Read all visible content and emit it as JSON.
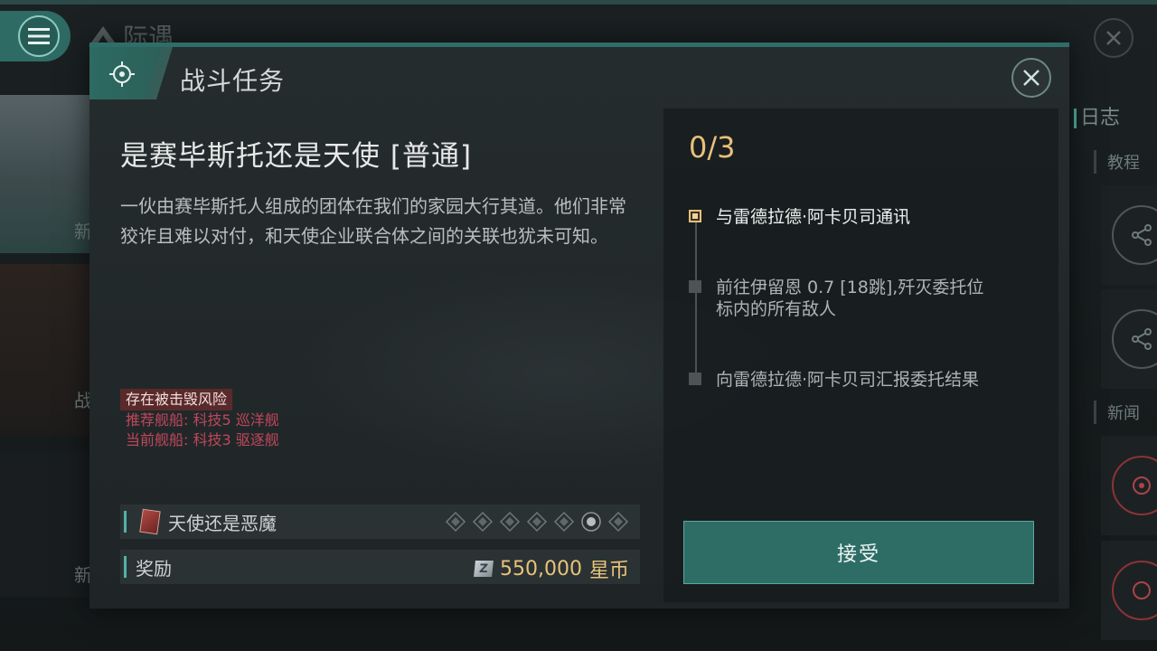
{
  "background": {
    "title": "际遇",
    "left_labels": [
      "新",
      "战",
      "新"
    ],
    "right_panel": {
      "title": "日志",
      "sections": [
        "教程",
        "新闻"
      ]
    }
  },
  "modal": {
    "header_title": "战斗任务",
    "mission_title": "是赛毕斯托还是天使 [普通]",
    "description": "一伙由赛毕斯托人组成的团体在我们的家园大行其道。他们非常狡诈且难以对付，和天使企业联合体之间的关联也犹未可知。",
    "risk": {
      "tag": "存在被击毁风险",
      "recommended": "推荐舰船: 科技5 巡洋舰",
      "current": "当前舰船: 科技3 驱逐舰"
    },
    "item_row": {
      "label": "天使还是恶魔",
      "icon": "mission-card-icon",
      "slots": [
        {
          "filled": false
        },
        {
          "filled": false
        },
        {
          "filled": false
        },
        {
          "filled": false
        },
        {
          "filled": false
        },
        {
          "filled": true
        },
        {
          "filled": false
        }
      ]
    },
    "reward_row": {
      "label": "奖励",
      "amount": "550,000",
      "unit": "星币",
      "icon": "star-coin-icon"
    },
    "objectives": {
      "progress": "0/3",
      "items": [
        {
          "text": "与雷德拉德·阿卡贝司通讯",
          "active": true
        },
        {
          "text": "前往伊留恩 0.7 [18跳],歼灭委托位标内的所有敌人",
          "active": false
        },
        {
          "text": "向雷德拉德·阿卡贝司汇报委托结果",
          "active": false
        }
      ]
    },
    "accept_label": "接受"
  },
  "colors": {
    "accent": "#2e6d66",
    "gold": "#e8c07a",
    "danger": "#c0475a"
  }
}
